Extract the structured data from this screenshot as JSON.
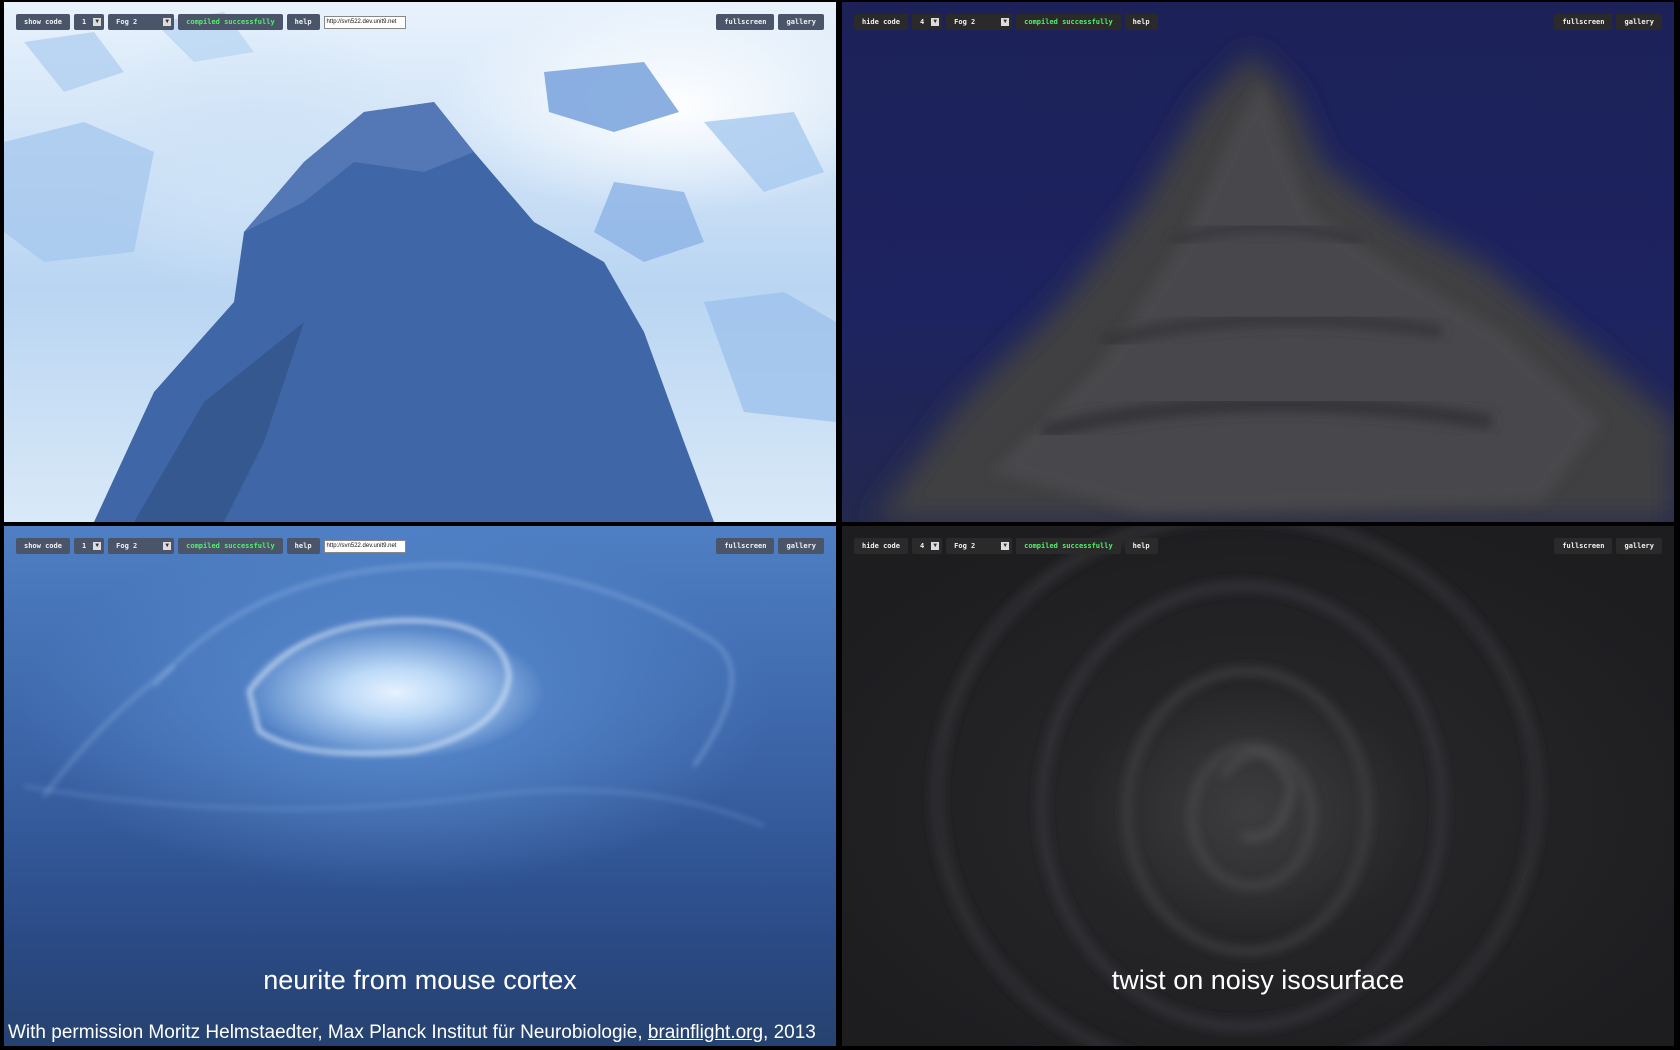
{
  "panels": {
    "top_left": {
      "toolbar": {
        "code_toggle": "show code",
        "quality_value": "1",
        "preset_value": "Fog 2",
        "status": "compiled successfully",
        "help": "help",
        "url": "http://svn522.dev.unit9.net",
        "fullscreen": "fullscreen",
        "gallery": "gallery"
      }
    },
    "top_right": {
      "toolbar": {
        "code_toggle": "hide code",
        "quality_value": "4",
        "preset_value": "Fog 2",
        "status": "compiled successfully",
        "help": "help",
        "fullscreen": "fullscreen",
        "gallery": "gallery"
      }
    },
    "bottom_left": {
      "toolbar": {
        "code_toggle": "show code",
        "quality_value": "1",
        "preset_value": "Fog 2",
        "status": "compiled successfully",
        "help": "help",
        "url": "http://svn522.dev.unit9.net",
        "fullscreen": "fullscreen",
        "gallery": "gallery"
      },
      "caption": "neurite from mouse cortex"
    },
    "bottom_right": {
      "toolbar": {
        "code_toggle": "hide code",
        "quality_value": "4",
        "preset_value": "Fog 2",
        "status": "compiled successfully",
        "help": "help",
        "fullscreen": "fullscreen",
        "gallery": "gallery"
      },
      "caption": "twist on noisy isosurface"
    }
  },
  "credit": {
    "prefix": "With permission Moritz Helmstaedter, Max Planck Institut für Neurobiologie, ",
    "link": "brainflight.org",
    "suffix": ", 2013"
  },
  "colors": {
    "status_green": "#52f06b",
    "light_toolbar_bg": "#4b5569",
    "dark_toolbar_bg": "#2a2a2a"
  }
}
